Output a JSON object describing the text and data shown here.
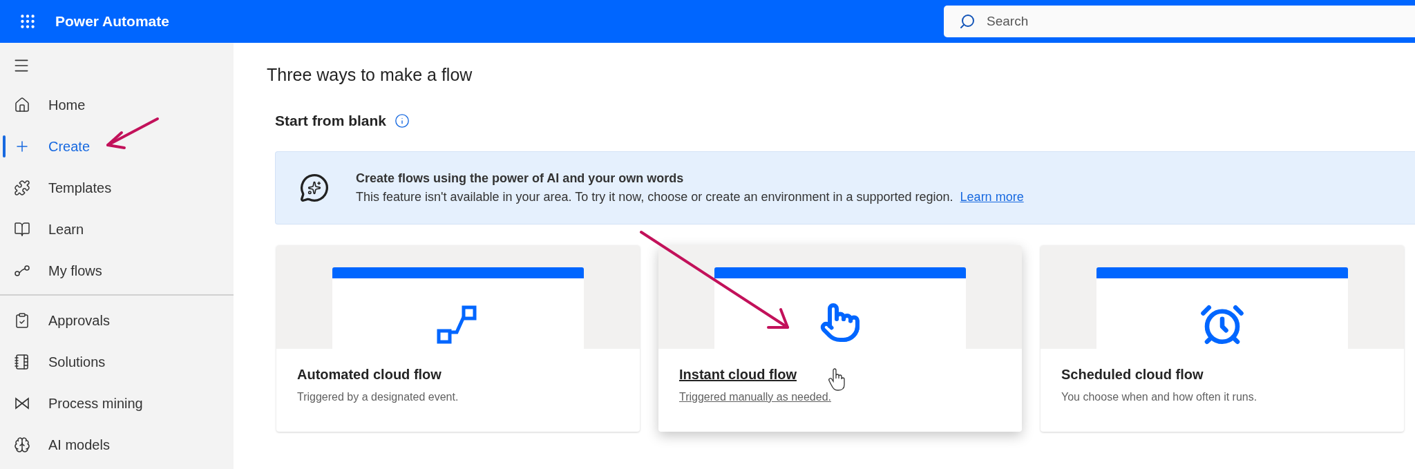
{
  "header": {
    "app_name": "Power Automate",
    "search": {
      "placeholder": "Search"
    }
  },
  "sidebar": {
    "sections": [
      {
        "items": [
          {
            "label": "Home",
            "selected": false
          },
          {
            "label": "Create",
            "selected": true
          },
          {
            "label": "Templates",
            "selected": false
          },
          {
            "label": "Learn",
            "selected": false
          },
          {
            "label": "My flows",
            "selected": false
          }
        ]
      },
      {
        "items": [
          {
            "label": "Approvals",
            "selected": false
          },
          {
            "label": "Solutions",
            "selected": false
          },
          {
            "label": "Process mining",
            "selected": false
          },
          {
            "label": "AI models",
            "selected": false
          }
        ]
      }
    ]
  },
  "main": {
    "title": "Three ways to make a flow",
    "section_title": "Start from blank",
    "banner": {
      "title": "Create flows using the power of AI and your own words",
      "text": "This feature isn't available in your area. To try it now, choose or create an environment in a supported region.",
      "link": "Learn more"
    },
    "cards": [
      {
        "kind": "automated",
        "title": "Automated cloud flow",
        "description": "Triggered by a designated event.",
        "hovered": false
      },
      {
        "kind": "instant",
        "title": "Instant cloud flow",
        "description": "Triggered manually as needed.",
        "hovered": true
      },
      {
        "kind": "scheduled",
        "title": "Scheduled cloud flow",
        "description": "You choose when and how often it runs.",
        "hovered": false
      }
    ]
  }
}
